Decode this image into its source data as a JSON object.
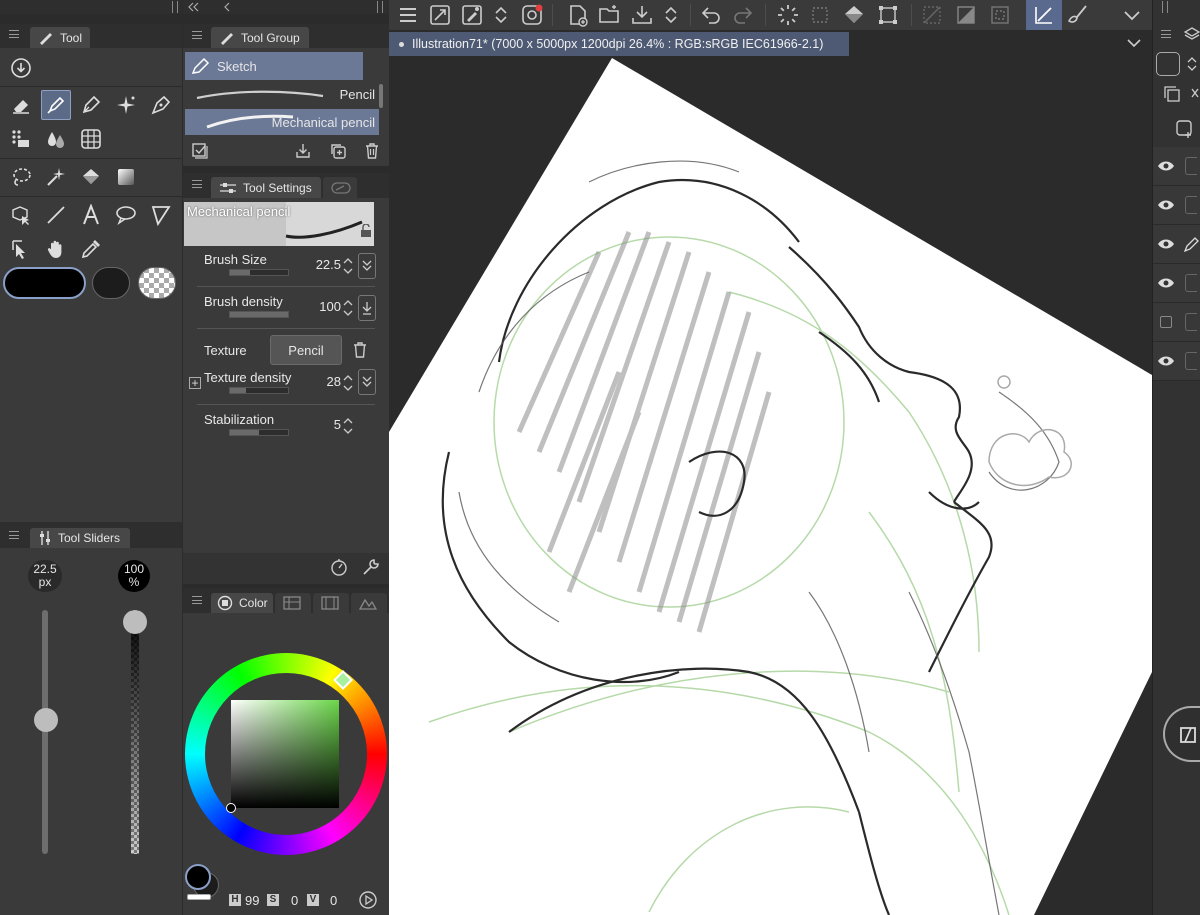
{
  "tool_panel": {
    "tab_label": "Tool"
  },
  "tool_group_panel": {
    "tab_label": "Tool Group",
    "group_name": "Sketch",
    "brushes": [
      "Pencil",
      "Mechanical pencil"
    ]
  },
  "tool_settings": {
    "tab_label": "Tool Settings",
    "preset_name": "Mechanical pencil",
    "brush_size_label": "Brush Size",
    "brush_size_value": "22.5",
    "brush_size_fraction": 0.35,
    "brush_density_label": "Brush density",
    "brush_density_value": "100",
    "brush_density_fraction": 1.0,
    "texture_label": "Texture",
    "texture_value": "Pencil",
    "texture_density_label": "Texture density",
    "texture_density_value": "28",
    "texture_density_fraction": 0.28,
    "stabilization_label": "Stabilization",
    "stabilization_value": "5",
    "stabilization_fraction": 0.5
  },
  "tool_sliders": {
    "tab_label": "Tool Sliders",
    "size_value": "22.5",
    "size_unit": "px",
    "size_fraction": 0.55,
    "opacity_value": "100",
    "opacity_unit": "%",
    "opacity_fraction": 1.0
  },
  "color_panel": {
    "tab_label": "Color",
    "h_label": "H",
    "h_value": "99",
    "s_label": "S",
    "s_value": "0",
    "v_label": "V",
    "v_value": "0",
    "main_color": "#000000",
    "hue_color": "#6bd64a"
  },
  "canvas": {
    "document_title": "Illustration71* (7000 x 5000px 1200dpi 26.4% : RGB:sRGB IEC61966-2.1)"
  }
}
